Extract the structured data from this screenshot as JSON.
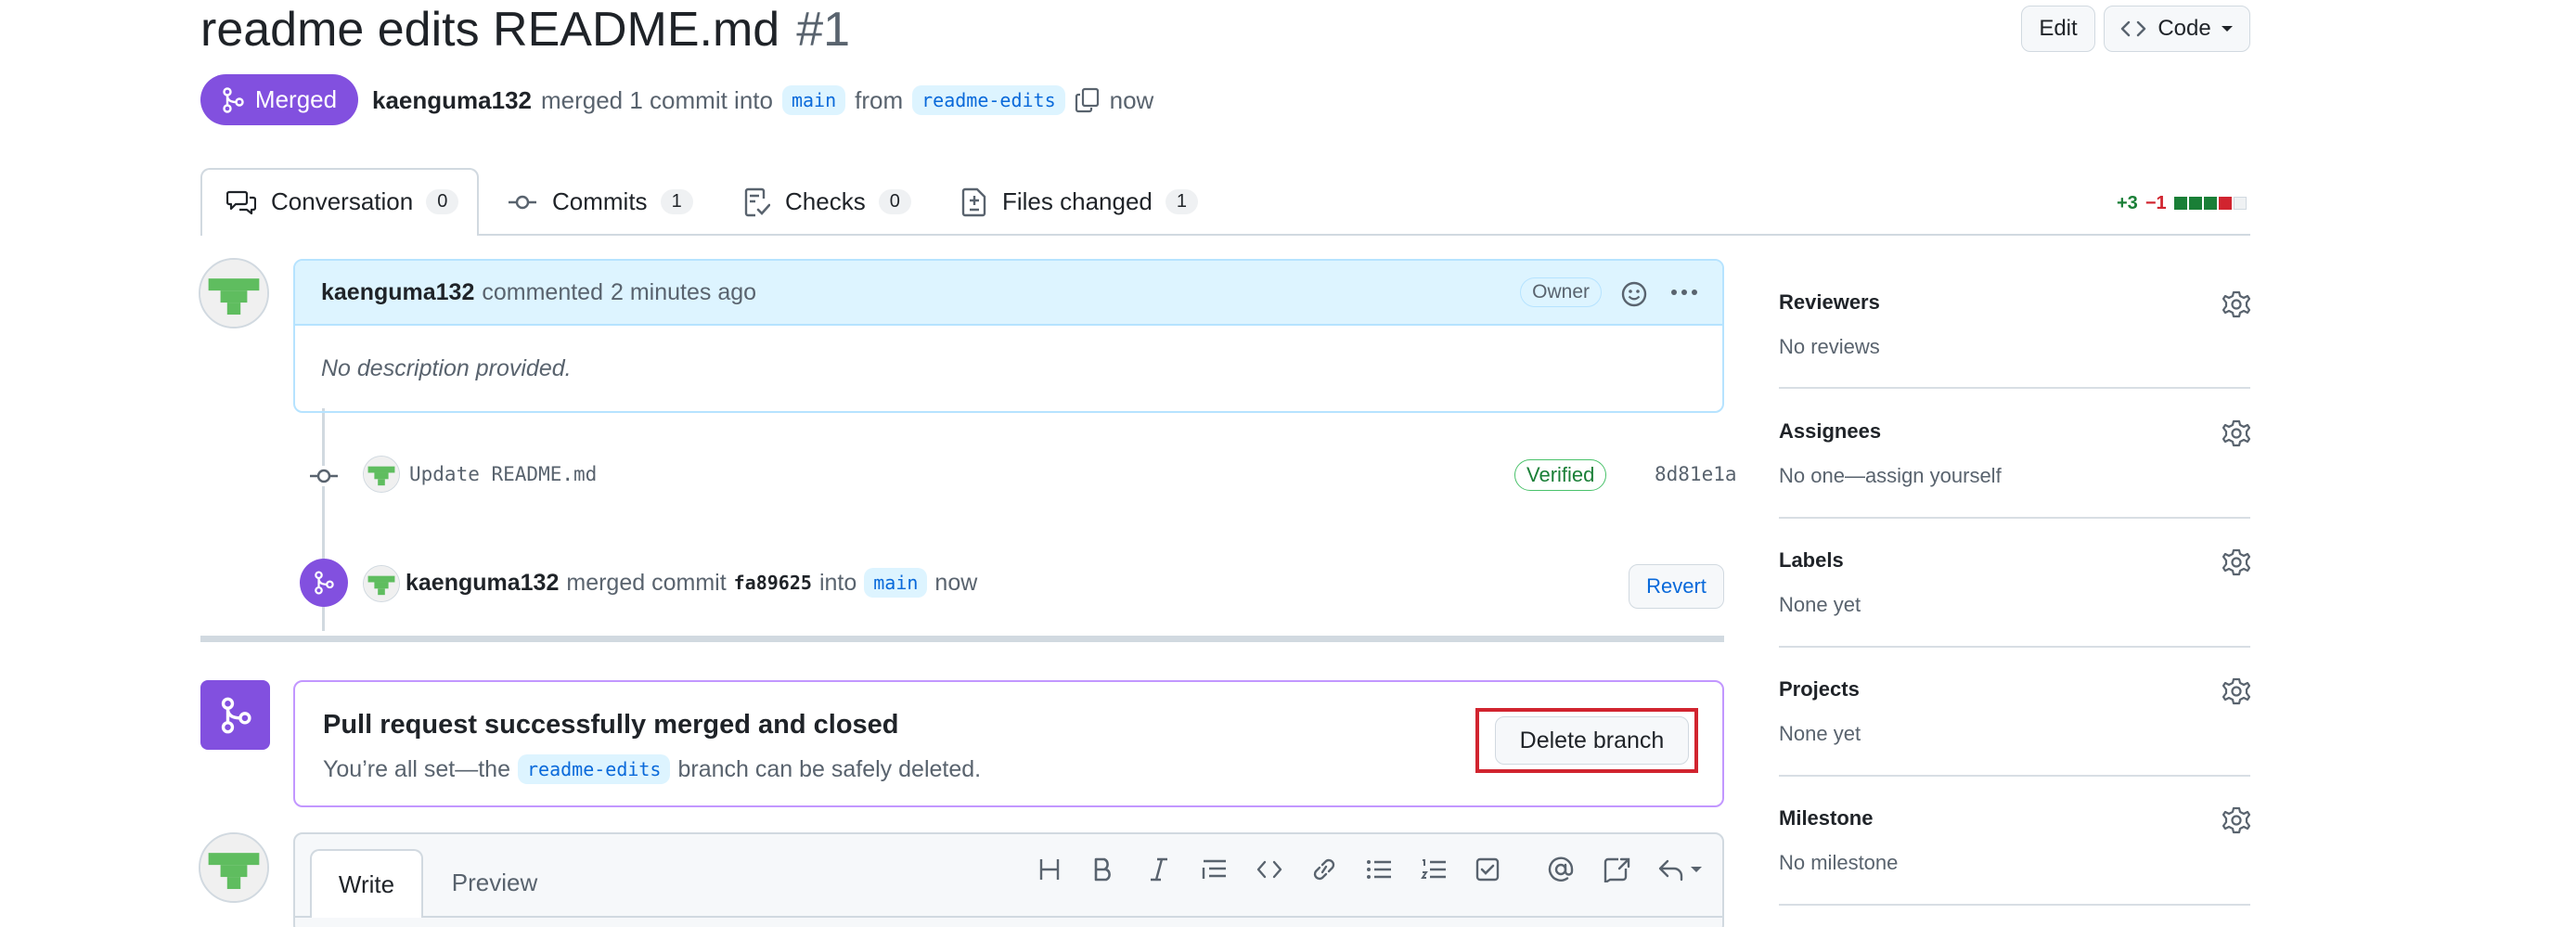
{
  "pr": {
    "title": "readme edits README.md",
    "number": "#1",
    "state_badge": "Merged",
    "author": "kaenguma132",
    "summary_merged": "merged 1 commit into",
    "base_branch": "main",
    "from_word": "from",
    "head_branch": "readme-edits",
    "when": "now"
  },
  "header_buttons": {
    "edit": "Edit",
    "code": "Code"
  },
  "tabs": [
    {
      "label": "Conversation",
      "count": "0"
    },
    {
      "label": "Commits",
      "count": "1"
    },
    {
      "label": "Checks",
      "count": "0"
    },
    {
      "label": "Files changed",
      "count": "1"
    }
  ],
  "diffstat": {
    "additions": "+3",
    "deletions": "−1",
    "add_color": "#1a7f37",
    "del_color": "#d1242f"
  },
  "comment": {
    "author": "kaenguma132",
    "action": "commented",
    "time": "2 minutes ago",
    "role": "Owner",
    "body": "No description provided."
  },
  "commit": {
    "message": "Update README.md",
    "verified": "Verified",
    "sha": "8d81e1a"
  },
  "merge_event": {
    "author": "kaenguma132",
    "action": "merged commit",
    "sha": "fa89625",
    "into_word": "into",
    "branch": "main",
    "when": "now",
    "revert": "Revert"
  },
  "merged_box": {
    "title": "Pull request successfully merged and closed",
    "desc_prefix": "You’re all set—the",
    "branch": "readme-edits",
    "desc_suffix": "branch can be safely deleted.",
    "delete_button": "Delete branch"
  },
  "editor": {
    "tabs": [
      "Write",
      "Preview"
    ],
    "toolbar_icons": [
      "heading-icon",
      "bold-icon",
      "italic-icon",
      "quote-icon",
      "code-icon",
      "link-icon",
      "unordered-list-icon",
      "ordered-list-icon",
      "task-list-icon",
      "mention-icon",
      "cross-reference-icon",
      "reply-icon"
    ]
  },
  "sidebar": [
    {
      "title": "Reviewers",
      "value": "No reviews"
    },
    {
      "title": "Assignees",
      "value": "No one—assign yourself"
    },
    {
      "title": "Labels",
      "value": "None yet"
    },
    {
      "title": "Projects",
      "value": "None yet"
    },
    {
      "title": "Milestone",
      "value": "No milestone"
    }
  ],
  "colors": {
    "merged_purple": "#8250df",
    "link_blue": "#0969da",
    "comment_header_bg": "#ddf4ff",
    "highlight_red": "#d1242f"
  }
}
